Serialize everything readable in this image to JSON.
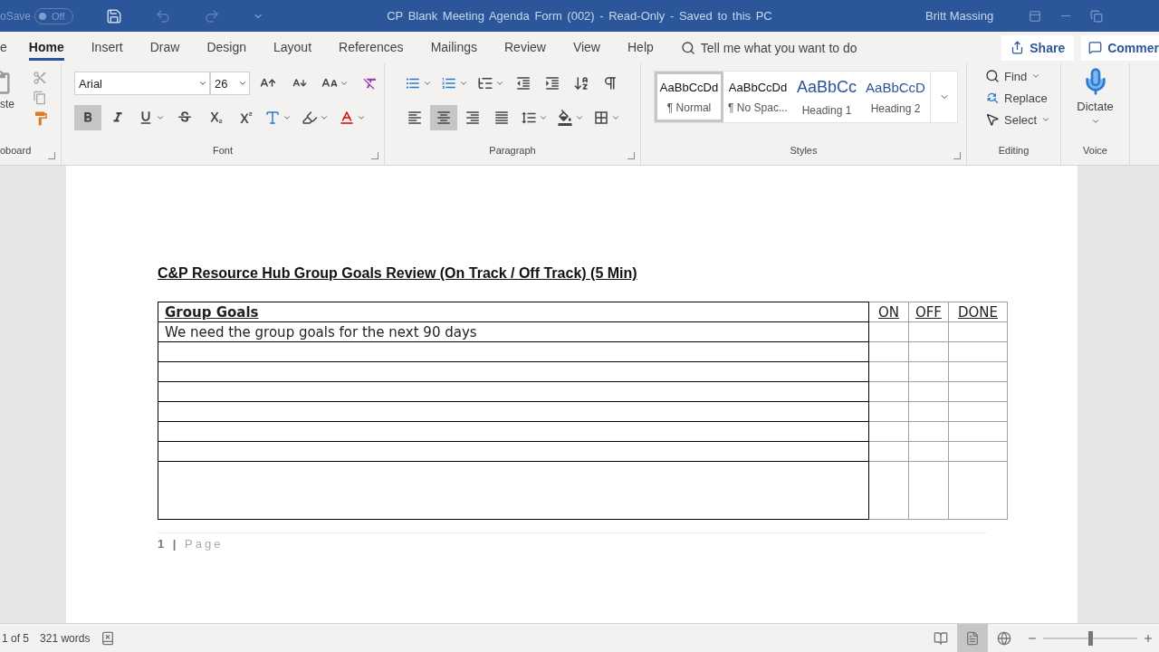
{
  "title_bar": {
    "autosave_label": "oSave",
    "autosave_toggle": {
      "label": "Off",
      "on": false
    },
    "title": "CP Blank Meeting Agenda Form (002) - Read-Only - Saved to this PC",
    "user": "Britt Massing"
  },
  "ribbon_tabs": [
    {
      "label": "e",
      "selected": false
    },
    {
      "label": "Home",
      "selected": true
    },
    {
      "label": "Insert",
      "selected": false
    },
    {
      "label": "Draw",
      "selected": false
    },
    {
      "label": "Design",
      "selected": false
    },
    {
      "label": "Layout",
      "selected": false
    },
    {
      "label": "References",
      "selected": false
    },
    {
      "label": "Mailings",
      "selected": false
    },
    {
      "label": "Review",
      "selected": false
    },
    {
      "label": "View",
      "selected": false
    },
    {
      "label": "Help",
      "selected": false
    }
  ],
  "tell_me": {
    "placeholder": "Tell me what you want to do"
  },
  "share_button": "Share",
  "comments_button": "Commer",
  "clipboard": {
    "paste_label": "ste",
    "group_label": "oboard"
  },
  "font": {
    "font_name": "Arial",
    "font_size": "26",
    "group_label": "Font",
    "format_buttons": [
      {
        "kind": "bold",
        "selected": true
      },
      {
        "kind": "italic",
        "selected": false
      },
      {
        "kind": "underline",
        "selected": false
      },
      {
        "kind": "strikethrough",
        "selected": false
      },
      {
        "kind": "subscript",
        "selected": false
      },
      {
        "kind": "superscript",
        "selected": false
      },
      {
        "kind": "text_effects",
        "selected": false
      },
      {
        "kind": "highlight",
        "selected": false
      },
      {
        "kind": "font_color",
        "selected": false
      }
    ]
  },
  "paragraph": {
    "group_label": "Paragraph",
    "top_buttons": [
      {
        "kind": "bullets",
        "selected": false
      },
      {
        "kind": "numbering",
        "selected": false
      },
      {
        "kind": "multilevel",
        "selected": false
      },
      {
        "kind": "outdent",
        "selected": false
      },
      {
        "kind": "indent",
        "selected": false
      },
      {
        "kind": "sort",
        "selected": false
      },
      {
        "kind": "show_marks",
        "selected": false
      }
    ],
    "bottom_buttons": [
      {
        "kind": "align_left",
        "selected": false
      },
      {
        "kind": "align_center",
        "selected": true
      },
      {
        "kind": "align_right",
        "selected": false
      },
      {
        "kind": "justify",
        "selected": false
      },
      {
        "kind": "line_spacing",
        "selected": false
      },
      {
        "kind": "shading",
        "selected": false
      },
      {
        "kind": "borders",
        "selected": false
      }
    ]
  },
  "styles": {
    "group_label": "Styles",
    "items": [
      {
        "kind": "body",
        "sample": "AaBbCcDd",
        "name": "¶ Normal",
        "selected": true
      },
      {
        "kind": "body",
        "sample": "AaBbCcDd",
        "name": "¶ No Spac...",
        "selected": false
      },
      {
        "kind": "heading1",
        "sample": "AaBbCc",
        "name": "Heading 1",
        "selected": false
      },
      {
        "kind": "heading2",
        "sample": "AaBbCcD",
        "name": "Heading 2",
        "selected": false
      }
    ]
  },
  "editing": {
    "group_label": "Editing",
    "items": [
      {
        "kind": "find",
        "label": "Find"
      },
      {
        "kind": "replace",
        "label": "Replace"
      },
      {
        "kind": "select",
        "label": "Select"
      }
    ]
  },
  "voice": {
    "label": "Dictate",
    "group_label": "Voice"
  },
  "document": {
    "heading": "C&P Resource Hub Group Goals Review (On Track / Off Track) (5 Min)",
    "table": {
      "columns": [
        "Group Goals",
        "ON",
        "OFF",
        "DONE"
      ],
      "rows": [
        {
          "kind": "text",
          "goal": "We need the group goals for the next 90 days"
        },
        {
          "kind": "blank"
        },
        {
          "kind": "blank"
        },
        {
          "kind": "blank"
        },
        {
          "kind": "blank"
        },
        {
          "kind": "blank"
        },
        {
          "kind": "blank"
        },
        {
          "kind": "tall"
        }
      ]
    },
    "footer": "**1 |** Page"
  },
  "status_bar": {
    "page": "1 of 5",
    "words": "321 words",
    "views": [
      {
        "kind": "read",
        "selected": false
      },
      {
        "kind": "print",
        "selected": true
      },
      {
        "kind": "web",
        "selected": false
      }
    ],
    "zoom": {
      "level": 0.5
    }
  }
}
